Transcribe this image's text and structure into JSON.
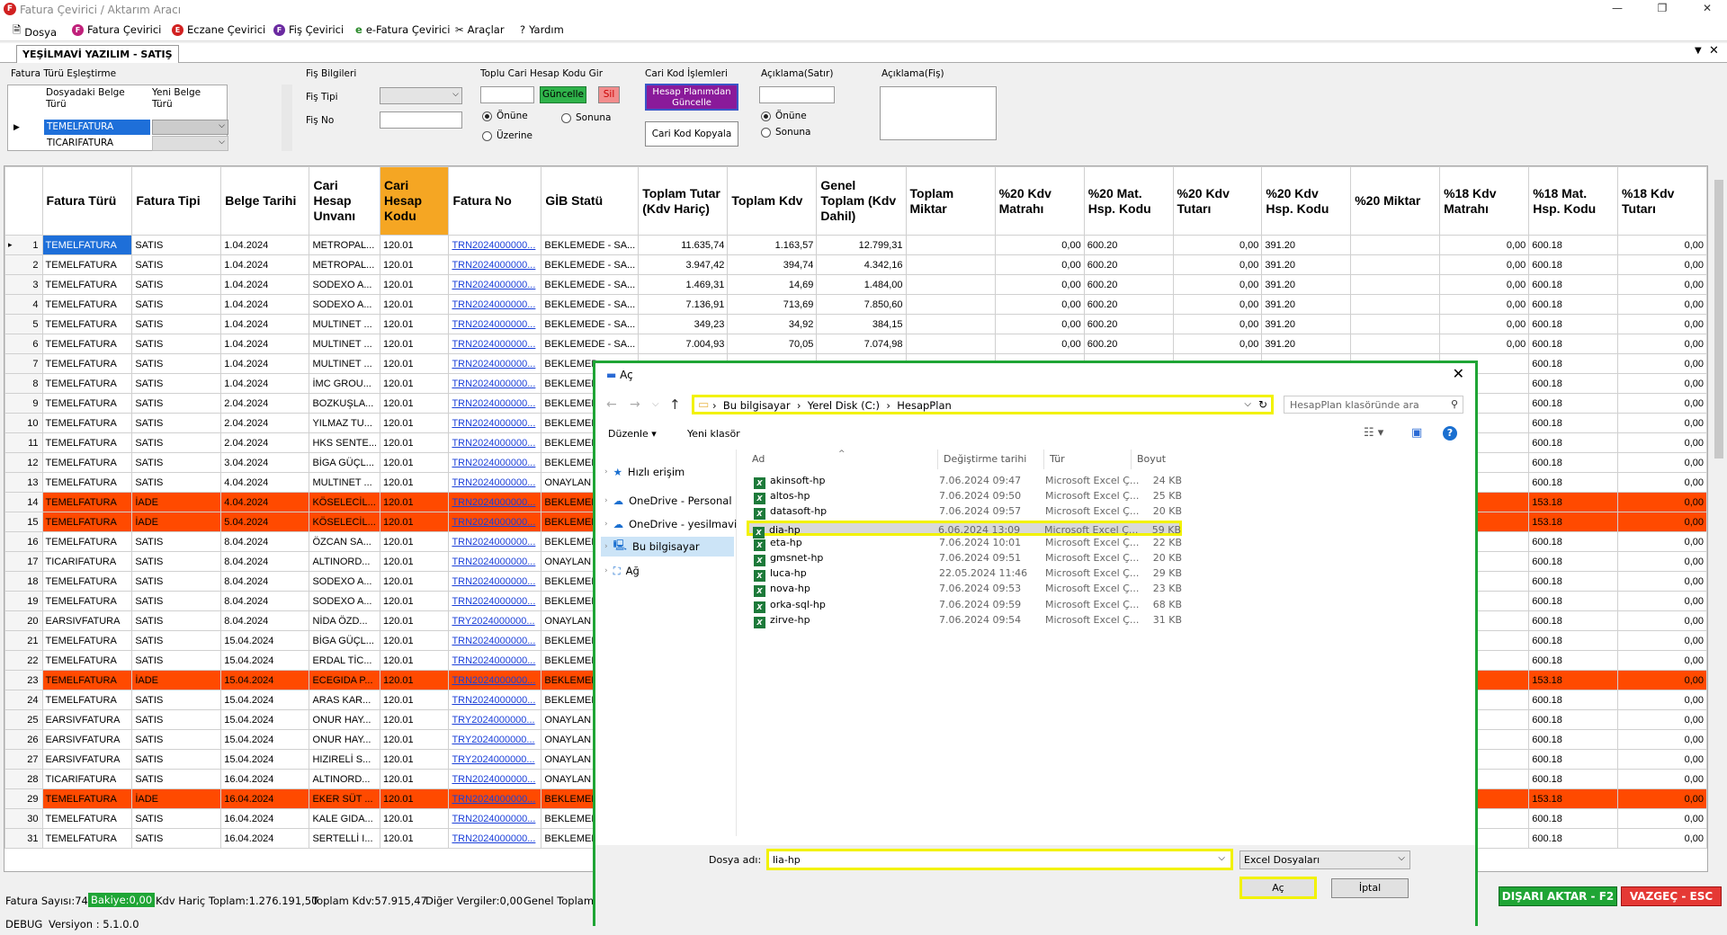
{
  "app": {
    "title": "Fatura Çevirici / Aktarım Aracı"
  },
  "menu": [
    {
      "label": "Dosya",
      "icon": "document-icon"
    },
    {
      "label": "Fatura Çevirici",
      "icon": "F",
      "color": "#c0207a"
    },
    {
      "label": "Eczane Çevirici",
      "icon": "E",
      "color": "#d12020"
    },
    {
      "label": "Fiş Çevirici",
      "icon": "F",
      "color": "#6a2aa0"
    },
    {
      "label": "e-Fatura Çevirici",
      "icon": "e-icon"
    },
    {
      "label": "Araçlar",
      "icon": "tools-icon"
    },
    {
      "label": "Yardım",
      "icon": "help-icon"
    }
  ],
  "tab": {
    "label": "YEŞİLMAVİ YAZILIM - SATIŞ"
  },
  "fatura_turu": {
    "title": "Fatura Türü Eşleştirme",
    "col1": "Dosyadaki Belge Türü",
    "col2": "Yeni Belge Türü",
    "rows": [
      "TEMELFATURA",
      "TICARIFATURA"
    ]
  },
  "fis_bilgileri": {
    "title": "Fiş Bilgileri",
    "tip_label": "Fiş Tipi",
    "no_label": "Fiş No"
  },
  "toplu": {
    "title": "Toplu Cari Hesap Kodu Gir",
    "update": "Güncelle",
    "delete": "Sil",
    "r1": "Önüne",
    "r2": "Sonuna",
    "r3": "Üzerine"
  },
  "cari_kod": {
    "title": "Cari Kod İşlemleri",
    "plan_btn": "Hesap Planımdan Güncelle",
    "copy_btn": "Cari Kod Kopyala"
  },
  "aciklama_satir": {
    "title": "Açıklama(Satır)",
    "r1": "Önüne",
    "r2": "Sonuna"
  },
  "aciklama_fis": {
    "title": "Açıklama(Fiş)"
  },
  "columns": [
    "Fatura Türü",
    "Fatura Tipi",
    "Belge Tarihi",
    "Cari Hesap Unvanı",
    "Cari Hesap Kodu",
    "Fatura No",
    "GİB Statü",
    "Toplam Tutar (Kdv Hariç)",
    "Toplam Kdv",
    "Genel Toplam (Kdv Dahil)",
    "Toplam Miktar",
    "%20 Kdv Matrahı",
    "%20 Mat. Hsp. Kodu",
    "%20 Kdv Tutarı",
    "%20 Kdv Hsp. Kodu",
    "%20 Miktar",
    "%18 Kdv Matrahı",
    "%18 Mat. Hsp. Kodu",
    "%18 Kdv Tutarı"
  ],
  "rows": [
    [
      "1",
      "TEMELFATURA",
      "SATIS",
      "1.04.2024",
      "METROPAL...",
      "120.01",
      "TRN2024000000...",
      "BEKLEMEDE - SA...",
      "11.635,74",
      "1.163,57",
      "12.799,31",
      "",
      "0,00",
      "600.20",
      "0,00",
      "391.20",
      "",
      "0,00",
      "600.18",
      "0,00"
    ],
    [
      "2",
      "TEMELFATURA",
      "SATIS",
      "1.04.2024",
      "METROPAL...",
      "120.01",
      "TRN2024000000...",
      "BEKLEMEDE - SA...",
      "3.947,42",
      "394,74",
      "4.342,16",
      "",
      "0,00",
      "600.20",
      "0,00",
      "391.20",
      "",
      "0,00",
      "600.18",
      "0,00"
    ],
    [
      "3",
      "TEMELFATURA",
      "SATIS",
      "1.04.2024",
      "SODEXO A...",
      "120.01",
      "TRN2024000000...",
      "BEKLEMEDE - SA...",
      "1.469,31",
      "14,69",
      "1.484,00",
      "",
      "0,00",
      "600.20",
      "0,00",
      "391.20",
      "",
      "0,00",
      "600.18",
      "0,00"
    ],
    [
      "4",
      "TEMELFATURA",
      "SATIS",
      "1.04.2024",
      "SODEXO A...",
      "120.01",
      "TRN2024000000...",
      "BEKLEMEDE - SA...",
      "7.136,91",
      "713,69",
      "7.850,60",
      "",
      "0,00",
      "600.20",
      "0,00",
      "391.20",
      "",
      "0,00",
      "600.18",
      "0,00"
    ],
    [
      "5",
      "TEMELFATURA",
      "SATIS",
      "1.04.2024",
      "MULTINET ...",
      "120.01",
      "TRN2024000000...",
      "BEKLEMEDE - SA...",
      "349,23",
      "34,92",
      "384,15",
      "",
      "0,00",
      "600.20",
      "0,00",
      "391.20",
      "",
      "0,00",
      "600.18",
      "0,00"
    ],
    [
      "6",
      "TEMELFATURA",
      "SATIS",
      "1.04.2024",
      "MULTINET ...",
      "120.01",
      "TRN2024000000...",
      "BEKLEMEDE - SA...",
      "7.004,93",
      "70,05",
      "7.074,98",
      "",
      "0,00",
      "600.20",
      "0,00",
      "391.20",
      "",
      "0,00",
      "600.18",
      "0,00"
    ],
    [
      "7",
      "TEMELFATURA",
      "SATIS",
      "1.04.2024",
      "MULTINET ...",
      "120.01",
      "TRN2024000000...",
      "BEKLEMED",
      "",
      "",
      "",
      "",
      "",
      "",
      "",
      "",
      "",
      "",
      "600.18",
      "0,00"
    ],
    [
      "8",
      "TEMELFATURA",
      "SATIS",
      "1.04.2024",
      "İMC GROU...",
      "120.01",
      "TRN2024000000...",
      "BEKLEMED",
      "",
      "",
      "",
      "",
      "",
      "",
      "",
      "",
      "",
      "",
      "600.18",
      "0,00"
    ],
    [
      "9",
      "TEMELFATURA",
      "SATIS",
      "2.04.2024",
      "BOZKUŞLA...",
      "120.01",
      "TRN2024000000...",
      "BEKLEMED",
      "",
      "",
      "",
      "",
      "",
      "",
      "",
      "",
      "",
      "",
      "600.18",
      "0,00"
    ],
    [
      "10",
      "TEMELFATURA",
      "SATIS",
      "2.04.2024",
      "YILMAZ TU...",
      "120.01",
      "TRN2024000000...",
      "BEKLEMED",
      "",
      "",
      "",
      "",
      "",
      "",
      "",
      "",
      "",
      "",
      "600.18",
      "0,00"
    ],
    [
      "11",
      "TEMELFATURA",
      "SATIS",
      "2.04.2024",
      "HKS SENTE...",
      "120.01",
      "TRN2024000000...",
      "BEKLEMED",
      "",
      "",
      "",
      "",
      "",
      "",
      "",
      "",
      "",
      "",
      "600.18",
      "0,00"
    ],
    [
      "12",
      "TEMELFATURA",
      "SATIS",
      "3.04.2024",
      "BİGA GÜÇL...",
      "120.01",
      "TRN2024000000...",
      "BEKLEMED",
      "",
      "",
      "",
      "",
      "",
      "",
      "",
      "",
      "",
      "",
      "600.18",
      "0,00"
    ],
    [
      "13",
      "TEMELFATURA",
      "SATIS",
      "4.04.2024",
      "MULTINET ...",
      "120.01",
      "TRN2024000000...",
      "ONAYLAN",
      "",
      "",
      "",
      "",
      "",
      "",
      "",
      "",
      "",
      "",
      "600.18",
      "0,00"
    ],
    [
      "14",
      "TEMELFATURA",
      "İADE",
      "4.04.2024",
      "KÖSELECİL...",
      "120.01",
      "TRN2024000000...",
      "BEKLEMED",
      "",
      "",
      "",
      "",
      "",
      "",
      "",
      "",
      "",
      "",
      "153.18",
      "0,00"
    ],
    [
      "15",
      "TEMELFATURA",
      "İADE",
      "5.04.2024",
      "KÖSELECİL...",
      "120.01",
      "TRN2024000000...",
      "BEKLEMED",
      "",
      "",
      "",
      "",
      "",
      "",
      "",
      "",
      "",
      "",
      "153.18",
      "0,00"
    ],
    [
      "16",
      "TEMELFATURA",
      "SATIS",
      "8.04.2024",
      "ÖZCAN SA...",
      "120.01",
      "TRN2024000000...",
      "BEKLEMED",
      "",
      "",
      "",
      "",
      "",
      "",
      "",
      "",
      "",
      "",
      "600.18",
      "0,00"
    ],
    [
      "17",
      "TICARIFATURA",
      "SATIS",
      "8.04.2024",
      "ALTINORD...",
      "120.01",
      "TRN2024000000...",
      "ONAYLAN",
      "",
      "",
      "",
      "",
      "",
      "",
      "",
      "",
      "",
      "",
      "600.18",
      "0,00"
    ],
    [
      "18",
      "TEMELFATURA",
      "SATIS",
      "8.04.2024",
      "SODEXO A...",
      "120.01",
      "TRN2024000000...",
      "BEKLEMED",
      "",
      "",
      "",
      "",
      "",
      "",
      "",
      "",
      "",
      "",
      "600.18",
      "0,00"
    ],
    [
      "19",
      "TEMELFATURA",
      "SATIS",
      "8.04.2024",
      "SODEXO A...",
      "120.01",
      "TRN2024000000...",
      "BEKLEMED",
      "",
      "",
      "",
      "",
      "",
      "",
      "",
      "",
      "",
      "",
      "600.18",
      "0,00"
    ],
    [
      "20",
      "EARSIVFATURA",
      "SATIS",
      "8.04.2024",
      "NİDA ÖZD...",
      "120.01",
      "TRY2024000000...",
      "ONAYLAN",
      "",
      "",
      "",
      "",
      "",
      "",
      "",
      "",
      "",
      "",
      "600.18",
      "0,00"
    ],
    [
      "21",
      "TEMELFATURA",
      "SATIS",
      "15.04.2024",
      "BİGA GÜÇL...",
      "120.01",
      "TRN2024000000...",
      "BEKLEMED",
      "",
      "",
      "",
      "",
      "",
      "",
      "",
      "",
      "",
      "",
      "600.18",
      "0,00"
    ],
    [
      "22",
      "TEMELFATURA",
      "SATIS",
      "15.04.2024",
      "ERDAL TİC...",
      "120.01",
      "TRN2024000000...",
      "BEKLEMED",
      "",
      "",
      "",
      "",
      "",
      "",
      "",
      "",
      "",
      "",
      "600.18",
      "0,00"
    ],
    [
      "23",
      "TEMELFATURA",
      "İADE",
      "15.04.2024",
      "ECEGIDA P...",
      "120.01",
      "TRN2024000000...",
      "BEKLEMED",
      "",
      "",
      "",
      "",
      "",
      "",
      "",
      "",
      "",
      "",
      "153.18",
      "0,00"
    ],
    [
      "24",
      "TEMELFATURA",
      "SATIS",
      "15.04.2024",
      "ARAS KAR...",
      "120.01",
      "TRN2024000000...",
      "BEKLEMED",
      "",
      "",
      "",
      "",
      "",
      "",
      "",
      "",
      "",
      "",
      "600.18",
      "0,00"
    ],
    [
      "25",
      "EARSIVFATURA",
      "SATIS",
      "15.04.2024",
      "ONUR HAY...",
      "120.01",
      "TRY2024000000...",
      "ONAYLAN",
      "",
      "",
      "",
      "",
      "",
      "",
      "",
      "",
      "",
      "",
      "600.18",
      "0,00"
    ],
    [
      "26",
      "EARSIVFATURA",
      "SATIS",
      "15.04.2024",
      "ONUR HAY...",
      "120.01",
      "TRY2024000000...",
      "ONAYLAN",
      "",
      "",
      "",
      "",
      "",
      "",
      "",
      "",
      "",
      "",
      "600.18",
      "0,00"
    ],
    [
      "27",
      "EARSIVFATURA",
      "SATIS",
      "15.04.2024",
      "HIZIRELİ S...",
      "120.01",
      "TRY2024000000...",
      "ONAYLAN",
      "",
      "",
      "",
      "",
      "",
      "",
      "",
      "",
      "",
      "",
      "600.18",
      "0,00"
    ],
    [
      "28",
      "TICARIFATURA",
      "SATIS",
      "16.04.2024",
      "ALTINORD...",
      "120.01",
      "TRN2024000000...",
      "ONAYLAN",
      "",
      "",
      "",
      "",
      "",
      "",
      "",
      "",
      "",
      "",
      "600.18",
      "0,00"
    ],
    [
      "29",
      "TEMELFATURA",
      "İADE",
      "16.04.2024",
      "EKER SÜT ...",
      "120.01",
      "TRN2024000000...",
      "BEKLEMED",
      "",
      "",
      "",
      "",
      "",
      "",
      "",
      "",
      "",
      "",
      "153.18",
      "0,00"
    ],
    [
      "30",
      "TEMELFATURA",
      "SATIS",
      "16.04.2024",
      "KALE GIDA...",
      "120.01",
      "TRN2024000000...",
      "BEKLEMED",
      "",
      "",
      "",
      "",
      "",
      "",
      "",
      "",
      "",
      "",
      "600.18",
      "0,00"
    ],
    [
      "31",
      "TEMELFATURA",
      "SATIS",
      "16.04.2024",
      "SERTELLİ I...",
      "120.01",
      "TRN2024000000...",
      "BEKLEMED",
      "",
      "",
      "",
      "",
      "",
      "",
      "",
      "",
      "",
      "",
      "600.18",
      "0,00"
    ]
  ],
  "red_rows": [
    14,
    15,
    23,
    29
  ],
  "status": {
    "fatura_sayisi": "Fatura Sayısı:74",
    "bakiye": "Bakiye:0,00",
    "kdv_haric": "Kdv Hariç Toplam:1.276.191,50",
    "toplam_kdv": "Toplam Kdv:57.915,47",
    "diger": "Diğer Vergiler:0,00",
    "genel": "Genel Toplam:",
    "export": "DIŞARI AKTAR - F2",
    "cancel": "VAZGEÇ - ESC"
  },
  "bottom": {
    "debug": "DEBUG",
    "version": "Versiyon : 5.1.0.0"
  },
  "dialog": {
    "title": "Aç",
    "breadcrumb": [
      "Bu bilgisayar",
      "Yerel Disk (C:)",
      "HesapPlan"
    ],
    "search_placeholder": "HesapPlan klasöründe ara",
    "organize": "Düzenle",
    "new_folder": "Yeni klasör",
    "nav": [
      "Hızlı erişim",
      "OneDrive - Personal",
      "OneDrive - yesilmavi",
      "Bu bilgisayar",
      "Ağ"
    ],
    "headers": {
      "name": "Ad",
      "date": "Değiştirme tarihi",
      "type": "Tür",
      "size": "Boyut"
    },
    "files": [
      {
        "name": "akinsoft-hp",
        "date": "7.06.2024 09:47",
        "type": "Microsoft Excel Ç...",
        "size": "24 KB"
      },
      {
        "name": "altos-hp",
        "date": "7.06.2024 09:50",
        "type": "Microsoft Excel Ç...",
        "size": "25 KB"
      },
      {
        "name": "datasoft-hp",
        "date": "7.06.2024 09:57",
        "type": "Microsoft Excel Ç...",
        "size": "20 KB"
      },
      {
        "name": "dia-hp",
        "date": "6.06.2024 13:09",
        "type": "Microsoft Excel Ç...",
        "size": "59 KB"
      },
      {
        "name": "eta-hp",
        "date": "7.06.2024 10:01",
        "type": "Microsoft Excel Ç...",
        "size": "22 KB"
      },
      {
        "name": "gmsnet-hp",
        "date": "7.06.2024 09:51",
        "type": "Microsoft Excel Ç...",
        "size": "20 KB"
      },
      {
        "name": "luca-hp",
        "date": "22.05.2024 11:46",
        "type": "Microsoft Excel Ç...",
        "size": "29 KB"
      },
      {
        "name": "nova-hp",
        "date": "7.06.2024 09:53",
        "type": "Microsoft Excel Ç...",
        "size": "23 KB"
      },
      {
        "name": "orka-sql-hp",
        "date": "7.06.2024 09:59",
        "type": "Microsoft Excel Ç...",
        "size": "68 KB"
      },
      {
        "name": "zirve-hp",
        "date": "7.06.2024 09:54",
        "type": "Microsoft Excel Ç...",
        "size": "31 KB"
      }
    ],
    "selected_file": "dia-hp",
    "filename_label": "Dosya adı:",
    "filename_value": "lia-hp",
    "filter": "Excel Dosyaları",
    "open": "Aç",
    "cancel": "İptal"
  }
}
